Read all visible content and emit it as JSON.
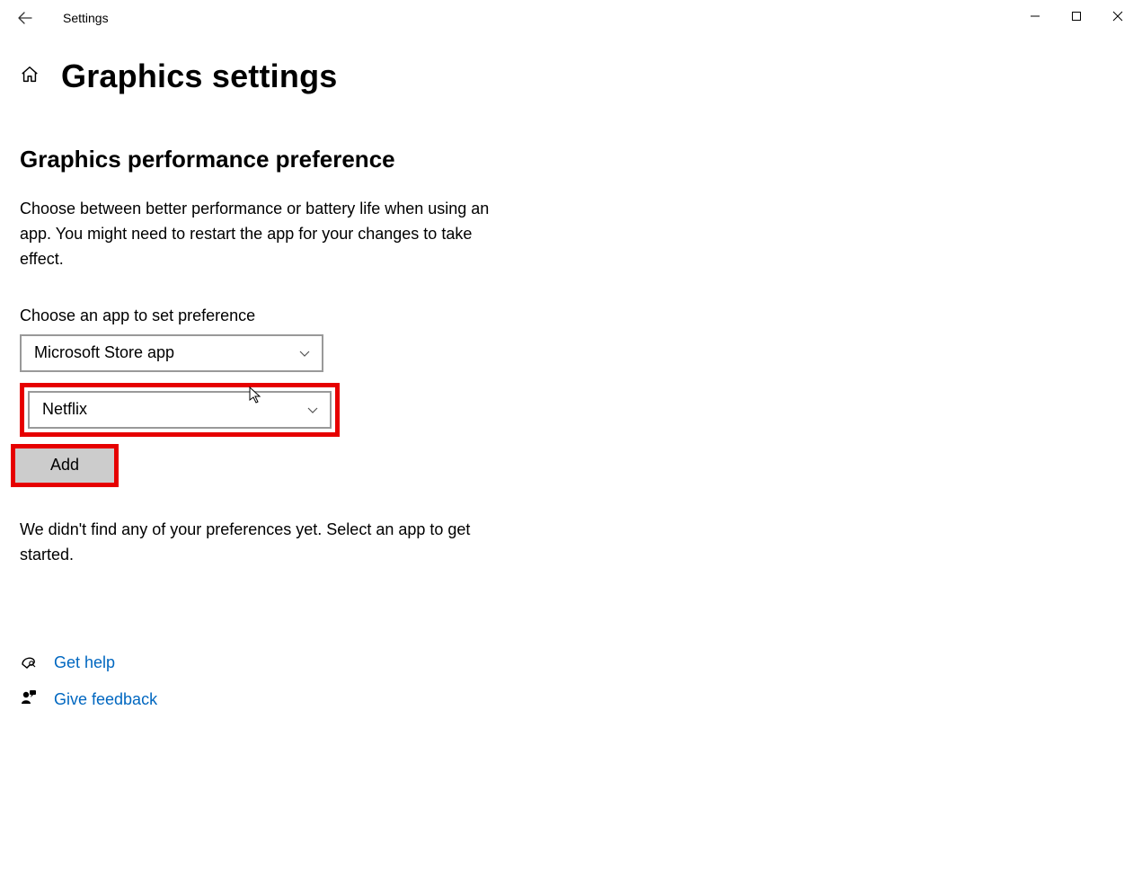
{
  "window": {
    "app_name": "Settings"
  },
  "page": {
    "title": "Graphics settings",
    "section_title": "Graphics performance preference",
    "description": "Choose between better performance or battery life when using an app. You might need to restart the app for your changes to take effect.",
    "choose_label": "Choose an app to set preference",
    "combo_app_type": "Microsoft Store app",
    "combo_app_select": "Netflix",
    "add_button": "Add",
    "status": "We didn't find any of your preferences yet. Select an app to get started."
  },
  "footer": {
    "help": "Get help",
    "feedback": "Give feedback"
  }
}
